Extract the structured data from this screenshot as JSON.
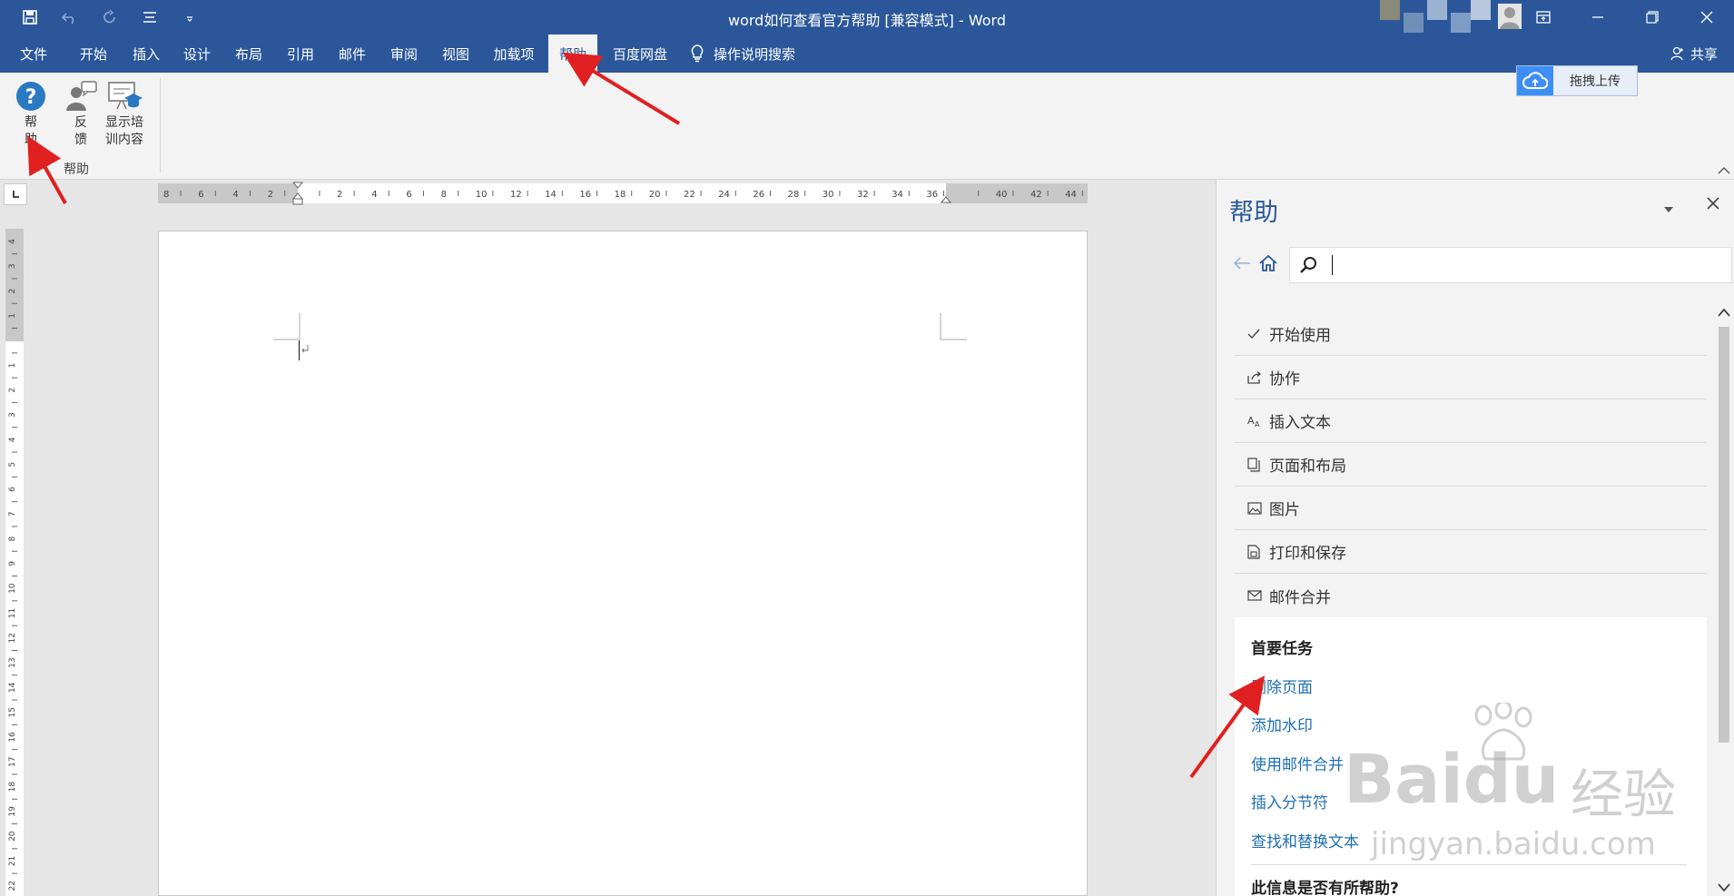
{
  "window": {
    "title": "word如何查看官方帮助 [兼容模式]  -  Word"
  },
  "tabs": [
    {
      "label": "文件"
    },
    {
      "label": "开始"
    },
    {
      "label": "插入"
    },
    {
      "label": "设计"
    },
    {
      "label": "布局"
    },
    {
      "label": "引用"
    },
    {
      "label": "邮件"
    },
    {
      "label": "审阅"
    },
    {
      "label": "视图"
    },
    {
      "label": "加载项"
    },
    {
      "label": "帮助",
      "active": true
    },
    {
      "label": "百度网盘"
    }
  ],
  "tell_me": {
    "label": "操作说明搜索",
    "icon": "lightbulb-icon"
  },
  "share": {
    "label": "共享",
    "icon": "person-icon"
  },
  "ribbon": {
    "buttons": [
      {
        "line1": "帮",
        "line2": "助",
        "icon": "help-question-icon"
      },
      {
        "line1": "反",
        "line2": "馈",
        "icon": "feedback-icon"
      },
      {
        "line1": "显示培",
        "line2": "训内容",
        "icon": "training-icon"
      }
    ],
    "group_label": "帮助",
    "upload_label": "拖拽上传"
  },
  "ruler": {
    "labels": [
      "8",
      "6",
      "4",
      "2",
      "",
      "2",
      "4",
      "6",
      "8",
      "10",
      "12",
      "14",
      "16",
      "18",
      "20",
      "22",
      "24",
      "26",
      "28",
      "30",
      "32",
      "34",
      "36",
      "",
      "40",
      "42",
      "44"
    ],
    "vlabels": [
      "4",
      "3",
      "2",
      "1",
      "",
      "1",
      "2",
      "3",
      "4",
      "5",
      "6",
      "7",
      "8",
      "9",
      "10",
      "11",
      "12",
      "13",
      "14",
      "15",
      "16",
      "17",
      "18",
      "19",
      "20",
      "21",
      "22"
    ]
  },
  "help_pane": {
    "title": "帮助",
    "search": {
      "value": "",
      "placeholder": ""
    },
    "categories": [
      {
        "label": "开始使用",
        "icon": "check-icon"
      },
      {
        "label": "协作",
        "icon": "share-icon"
      },
      {
        "label": "插入文本",
        "icon": "text-size-icon"
      },
      {
        "label": "页面和布局",
        "icon": "pages-icon"
      },
      {
        "label": "图片",
        "icon": "picture-icon"
      },
      {
        "label": "打印和保存",
        "icon": "print-save-icon"
      },
      {
        "label": "邮件合并",
        "icon": "mail-icon"
      }
    ],
    "top_tasks": {
      "title": "首要任务",
      "links": [
        "删除页面",
        "添加水印",
        "使用邮件合并",
        "插入分节符",
        "查找和替换文本"
      ]
    },
    "helpful_question": "此信息是否有所帮助?"
  },
  "watermark": {
    "brand": "Baidu",
    "cn": "经验",
    "url": "jingyan.baidu.com"
  },
  "colors": {
    "word_blue": "#2b579a",
    "link_blue": "#1e6fb5",
    "arrow_red": "#e02020"
  }
}
